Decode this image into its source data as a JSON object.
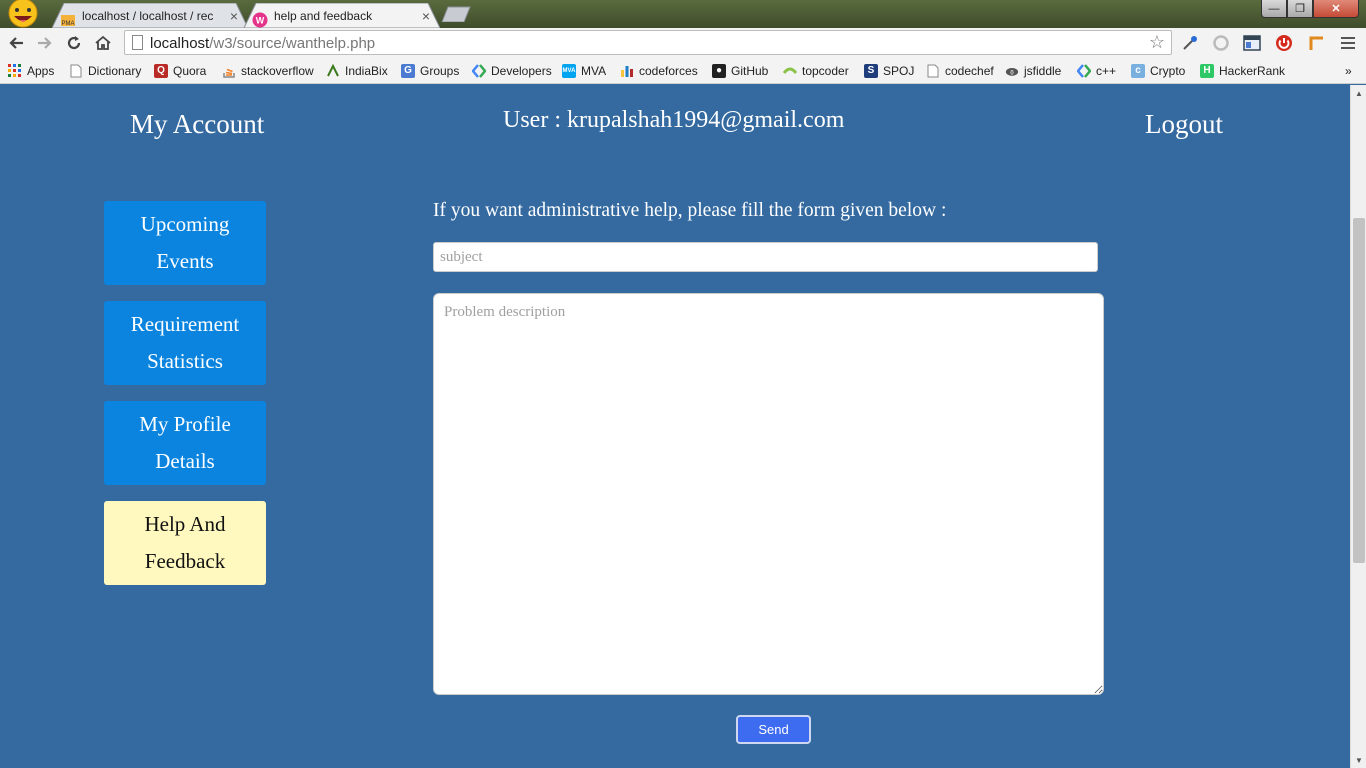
{
  "browser": {
    "tabs": [
      {
        "title": "localhost / localhost / rec",
        "active": false,
        "favicon": "phpmyadmin-icon"
      },
      {
        "title": "help and feedback",
        "active": true,
        "favicon": "wamp-icon"
      }
    ],
    "close_glyph": "×",
    "window_controls": {
      "minimize": "—",
      "maximize": "❐",
      "close": "✕"
    },
    "address": {
      "host": "localhost",
      "path": "/w3/source/wanthelp.php"
    },
    "bookmarks": [
      {
        "label": "Apps",
        "icon": "apps-grid-icon"
      },
      {
        "label": "Dictionary",
        "icon": "page-icon"
      },
      {
        "label": "Quora",
        "icon": "quora-icon"
      },
      {
        "label": "stackoverflow",
        "icon": "stackoverflow-icon"
      },
      {
        "label": "IndiaBix",
        "icon": "indiabix-icon"
      },
      {
        "label": "Groups",
        "icon": "groups-icon"
      },
      {
        "label": "Developers",
        "icon": "developers-icon"
      },
      {
        "label": "MVA",
        "icon": "mva-icon"
      },
      {
        "label": "codeforces",
        "icon": "codeforces-icon"
      },
      {
        "label": "GitHub",
        "icon": "github-icon"
      },
      {
        "label": "topcoder",
        "icon": "topcoder-icon"
      },
      {
        "label": "SPOJ",
        "icon": "spoj-icon"
      },
      {
        "label": "codechef",
        "icon": "page-icon"
      },
      {
        "label": "jsfiddle",
        "icon": "jsfiddle-icon"
      },
      {
        "label": "c++",
        "icon": "developers-icon"
      },
      {
        "label": "Crypto",
        "icon": "crypto-icon"
      },
      {
        "label": "HackerRank",
        "icon": "hackerrank-icon"
      }
    ],
    "bookmarks_overflow": "»"
  },
  "header": {
    "my_account": "My Account",
    "user": "User : krupalshah1994@gmail.com",
    "logout": "Logout"
  },
  "sidebar": {
    "items": [
      {
        "line1": "Upcoming",
        "line2": "Events",
        "active": false
      },
      {
        "line1": "Requirement",
        "line2": "Statistics",
        "active": false
      },
      {
        "line1": "My Profile",
        "line2": "Details",
        "active": false
      },
      {
        "line1": "Help And",
        "line2": "Feedback",
        "active": true
      }
    ]
  },
  "form": {
    "heading": "If you want administrative help, please fill the form given below :",
    "subject_placeholder": "subject",
    "description_placeholder": "Problem description",
    "send_label": "Send"
  },
  "colors": {
    "page_bg": "#346aa0",
    "nav_button": "#0a84df",
    "nav_active": "#fff9bf",
    "send_button": "#3e6cf0"
  }
}
